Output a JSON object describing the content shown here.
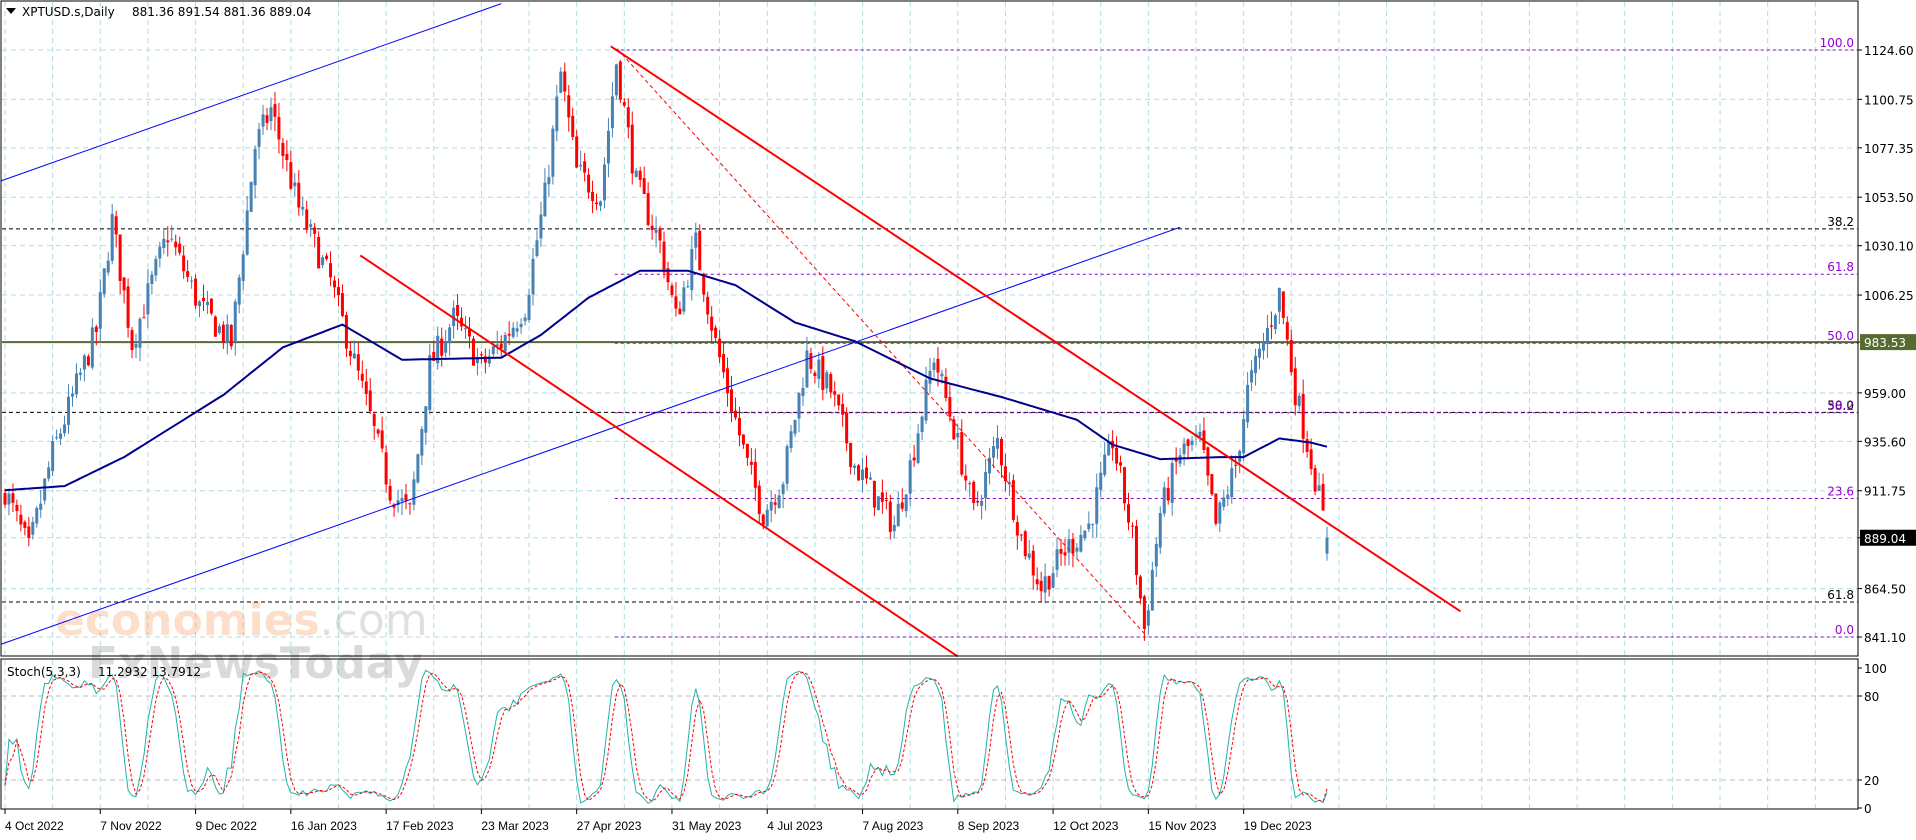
{
  "header": {
    "symbol": "XPTUSD.s,Daily",
    "ohlc": "881.36 891.54 881.36 889.04"
  },
  "indicator": {
    "label": "Stoch(5,3,3)",
    "values": "11.2932 13.7912"
  },
  "watermark": {
    "line1a": "economies",
    "line1b": ".com",
    "line2": "FxNewsToday"
  },
  "colors": {
    "up": "#4682b4",
    "down": "#ff0000",
    "ma": "#00008b",
    "channel": "#0000ff",
    "trend": "#ff0000",
    "fib": "#9400d3",
    "support": "#556b2f",
    "grid": "#b0dde0",
    "stoch_main": "#20b2aa",
    "stoch_signal": "#ff0000"
  },
  "chart_data": {
    "type": "candlestick",
    "title": "XPTUSD.s, Daily",
    "ylim": [
      841.1,
      1124.6
    ],
    "price_ticks": [
      "1124.60",
      "1100.75",
      "1077.35",
      "1053.50",
      "1030.10",
      "1006.25",
      "983.53",
      "959.00",
      "935.60",
      "911.75",
      "889.04",
      "864.50",
      "841.10"
    ],
    "highlighted_prices": {
      "support": "983.53",
      "last": "889.04"
    },
    "date_ticks": [
      "4 Oct 2022",
      "7 Nov 2022",
      "9 Dec 2022",
      "16 Jan 2023",
      "17 Feb 2023",
      "23 Mar 2023",
      "27 Apr 2023",
      "31 May 2023",
      "4 Jul 2023",
      "7 Aug 2023",
      "8 Sep 2023",
      "12 Oct 2023",
      "15 Nov 2023",
      "19 Dec 2023"
    ],
    "bars_per_date_tick": 24,
    "price_path": [
      [
        0,
        912
      ],
      [
        6,
        883
      ],
      [
        12,
        930
      ],
      [
        23,
        989
      ],
      [
        27,
        1042
      ],
      [
        32,
        983
      ],
      [
        41,
        1036
      ],
      [
        49,
        1001
      ],
      [
        57,
        983
      ],
      [
        63,
        1078
      ],
      [
        67,
        1096
      ],
      [
        74,
        1048
      ],
      [
        82,
        1013
      ],
      [
        91,
        954
      ],
      [
        97,
        912
      ],
      [
        102,
        901
      ],
      [
        107,
        972
      ],
      [
        113,
        995
      ],
      [
        120,
        972
      ],
      [
        125,
        983
      ],
      [
        131,
        1001
      ],
      [
        136,
        1054
      ],
      [
        140,
        1113
      ],
      [
        144,
        1066
      ],
      [
        150,
        1054
      ],
      [
        154,
        1119
      ],
      [
        159,
        1060
      ],
      [
        165,
        1031
      ],
      [
        169,
        995
      ],
      [
        174,
        1031
      ],
      [
        179,
        983
      ],
      [
        187,
        924
      ],
      [
        191,
        901
      ],
      [
        196,
        918
      ],
      [
        202,
        977
      ],
      [
        208,
        960
      ],
      [
        214,
        924
      ],
      [
        224,
        895
      ],
      [
        228,
        924
      ],
      [
        234,
        977
      ],
      [
        239,
        942
      ],
      [
        244,
        901
      ],
      [
        250,
        936
      ],
      [
        256,
        889
      ],
      [
        261,
        865
      ],
      [
        267,
        883
      ],
      [
        273,
        895
      ],
      [
        279,
        936
      ],
      [
        284,
        889
      ],
      [
        287,
        845
      ],
      [
        291,
        901
      ],
      [
        296,
        930
      ],
      [
        301,
        936
      ],
      [
        305,
        895
      ],
      [
        310,
        924
      ],
      [
        313,
        960
      ],
      [
        318,
        989
      ],
      [
        321,
        1007
      ],
      [
        325,
        960
      ],
      [
        330,
        918
      ],
      [
        333,
        889.04
      ]
    ],
    "moving_average": [
      [
        0,
        912
      ],
      [
        15,
        914
      ],
      [
        30,
        928
      ],
      [
        55,
        958
      ],
      [
        70,
        981
      ],
      [
        85,
        992
      ],
      [
        100,
        975
      ],
      [
        125,
        976
      ],
      [
        135,
        987
      ],
      [
        147,
        1005
      ],
      [
        160,
        1018
      ],
      [
        172,
        1018
      ],
      [
        184,
        1011
      ],
      [
        199,
        993
      ],
      [
        214,
        984
      ],
      [
        233,
        966
      ],
      [
        251,
        957
      ],
      [
        270,
        946
      ],
      [
        279,
        934
      ],
      [
        291,
        927
      ],
      [
        306,
        928
      ],
      [
        312,
        928
      ],
      [
        321,
        937
      ],
      [
        329,
        935
      ],
      [
        333,
        933
      ]
    ],
    "channel_lines": [
      {
        "from": [
          -1,
          1061.4
        ],
        "to": [
          125,
          1147
        ]
      },
      {
        "from": [
          -1,
          837.6
        ],
        "to": [
          296,
          1039
        ]
      }
    ],
    "trend_lines": [
      {
        "from": [
          89.5,
          1025.4
        ],
        "to": [
          240,
          831.7
        ]
      },
      {
        "from": [
          152.6,
          1126.4
        ],
        "to": [
          366.6,
          853.5
        ]
      }
    ],
    "dashed_trend": {
      "from": [
        154.2,
        1125.2
      ],
      "to": [
        287.5,
        841.7
      ]
    },
    "fib_purple": {
      "start_bar": 153.6,
      "levels": [
        {
          "label": "100.0",
          "price": 1124.6
        },
        {
          "label": "61.8",
          "price": 1016.3
        },
        {
          "label": "50.0",
          "price": 983.0
        },
        {
          "label": "38.2",
          "price": 949.4
        },
        {
          "label": "23.6",
          "price": 908.0
        },
        {
          "label": "0.0",
          "price": 841.1
        }
      ]
    },
    "fib_black": [
      {
        "label": "38.2",
        "price": 1038.2
      },
      {
        "label": "50.0",
        "price": 949.6
      },
      {
        "label": "61.8",
        "price": 858.0
      }
    ],
    "stochastic": {
      "ylim": [
        0,
        100
      ],
      "ticks": [
        "100",
        "80",
        "20",
        "0"
      ],
      "levels": [
        80,
        20
      ],
      "last_main": 11.2932,
      "last_signal": 13.7912
    }
  }
}
